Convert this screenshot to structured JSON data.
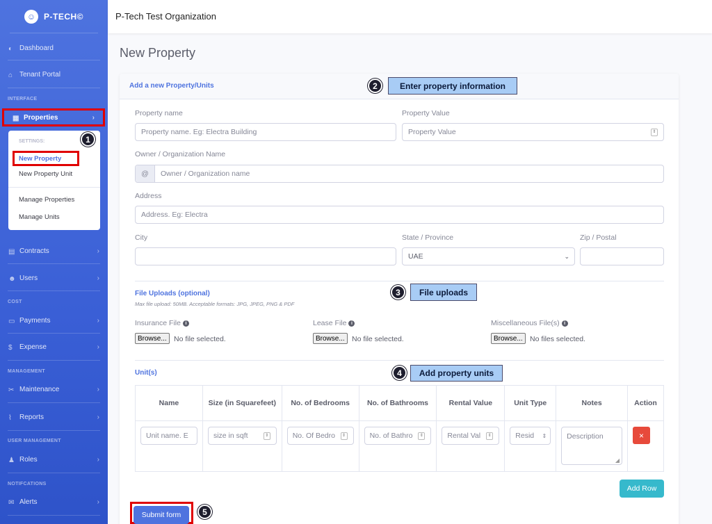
{
  "brand": {
    "name": "P-TECH©"
  },
  "topbar": {
    "org": "P-Tech Test Organization"
  },
  "sidebar": {
    "dashboard": "Dashboard",
    "tenant_portal": "Tenant Portal",
    "sec_interface": "INTERFACE",
    "properties": "Properties",
    "submenu": {
      "header": "SETTINGS:",
      "new_property": "New Property",
      "new_property_unit": "New Property Unit",
      "manage_properties": "Manage Properties",
      "manage_units": "Manage Units"
    },
    "contracts": "Contracts",
    "users": "Users",
    "sec_cost": "COST",
    "payments": "Payments",
    "expense": "Expense",
    "sec_management": "MANAGEMENT",
    "maintenance": "Maintenance",
    "reports": "Reports",
    "sec_user_mgmt": "USER MANAGEMENT",
    "roles": "Roles",
    "sec_notif": "NOTIFCATIONS",
    "alerts": "Alerts"
  },
  "page": {
    "title": "New Property",
    "card_title": "Add a new Property/Units"
  },
  "form": {
    "property_name_label": "Property name",
    "property_name_ph": "Property name. Eg: Electra Building",
    "property_value_label": "Property Value",
    "property_value_ph": "Property Value",
    "owner_label": "Owner / Organization Name",
    "owner_prefix": "@",
    "owner_ph": "Owner / Organization name",
    "address_label": "Address",
    "address_ph": "Address. Eg: Electra",
    "city_label": "City",
    "state_label": "State / Province",
    "state_value": "UAE",
    "zip_label": "Zip / Postal"
  },
  "uploads": {
    "title": "File Uploads (optional)",
    "note": "Max file upload: 50MB. Acceptable formats: JPG, JPEG, PNG & PDF",
    "insurance": "Insurance File",
    "lease": "Lease File",
    "misc": "Miscellaneous File(s)",
    "browse": "Browse...",
    "no_file": "No file selected.",
    "no_files": "No files selected."
  },
  "units": {
    "title": "Unit(s)",
    "headers": [
      "Name",
      "Size (in Squarefeet)",
      "No. of Bedrooms",
      "No. of Bathrooms",
      "Rental Value",
      "Unit Type",
      "Notes",
      "Action"
    ],
    "row": {
      "name_ph": "Unit name. E",
      "size_ph": "size in sqft",
      "bed_ph": "No. Of Bedro",
      "bath_ph": "No. of Bathro",
      "rent_ph": "Rental Val",
      "type": "Resid",
      "notes_ph": "Description",
      "remove": "×"
    },
    "add_row": "Add Row"
  },
  "submit": "Submit form",
  "callouts": {
    "c1": "1",
    "c2": "2",
    "c2_text": "Enter property information",
    "c3": "3",
    "c3_text": "File uploads",
    "c4": "4",
    "c4_text": "Add property units",
    "c5": "5"
  },
  "colors": {
    "primary": "#4e73df",
    "info": "#36b9cc",
    "danger": "#e74a3b",
    "highlight": "#e00000",
    "callout": "#a8ccf5"
  }
}
